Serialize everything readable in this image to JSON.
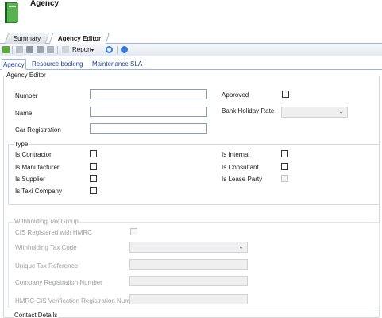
{
  "app": {
    "title": "Agency"
  },
  "tabs": [
    {
      "label": "Summary"
    },
    {
      "label": "Agency Editor"
    }
  ],
  "toolbar": {
    "report_label": "Report",
    "report_caret": "▾"
  },
  "subtabs": [
    {
      "label": "Agency"
    },
    {
      "label": "Resource booking"
    },
    {
      "label": "Maintenance SLA"
    }
  ],
  "agency_editor": {
    "title": "Agency Editor",
    "number_label": "Number",
    "number_value": "",
    "name_label": "Name",
    "name_value": "",
    "car_reg_label": "Car Registration",
    "car_reg_value": "",
    "approved_label": "Approved",
    "bank_holiday_label": "Bank Holiday Rate",
    "bank_holiday_value": ""
  },
  "type_group": {
    "title": "Type",
    "is_contractor": "Is Contractor",
    "is_manufacturer": "Is Manufacturer",
    "is_supplier": "Is Supplier",
    "is_taxi_company": "Is Taxi Company",
    "is_internal": "Is Internal",
    "is_consultant": "Is Consultant",
    "is_lease_party": "Is Lease Party"
  },
  "withholding": {
    "title": "Withholding Tax Group",
    "cis_registered": "CIS Registered with HMRC",
    "tax_code_label": "Withholding Tax Code",
    "utr_label": "Unique Tax Reference",
    "company_reg_label": "Company Registration Number",
    "hmrc_cis_label": "HMRC CIS Verification Registration Number"
  },
  "contact": {
    "title": "Contact Details"
  },
  "colors": {
    "accent": "#1f3f8f",
    "tab_border": "#9db6d6",
    "app_icon": "#3e9a3a"
  }
}
